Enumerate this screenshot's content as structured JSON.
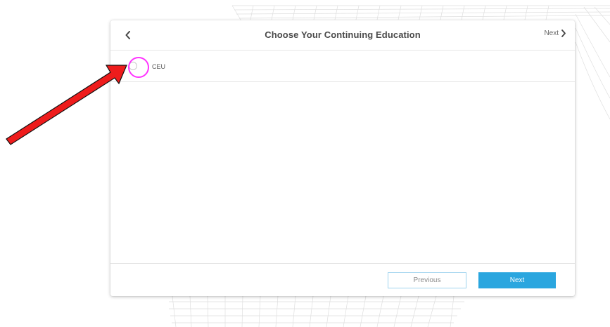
{
  "dialog": {
    "title": "Choose Your Continuing Education",
    "back_icon": "chevron-left-icon",
    "header_next_label": "Next",
    "header_next_icon": "chevron-right-icon"
  },
  "options": [
    {
      "label": "CEU",
      "selected": false
    }
  ],
  "footer": {
    "previous_label": "Previous",
    "next_label": "Next"
  },
  "colors": {
    "accent": "#2aa6df",
    "previous_border": "#9fd3ee",
    "annotation_arrow": "#ee1c1c",
    "annotation_circle": "#ff33ff"
  }
}
